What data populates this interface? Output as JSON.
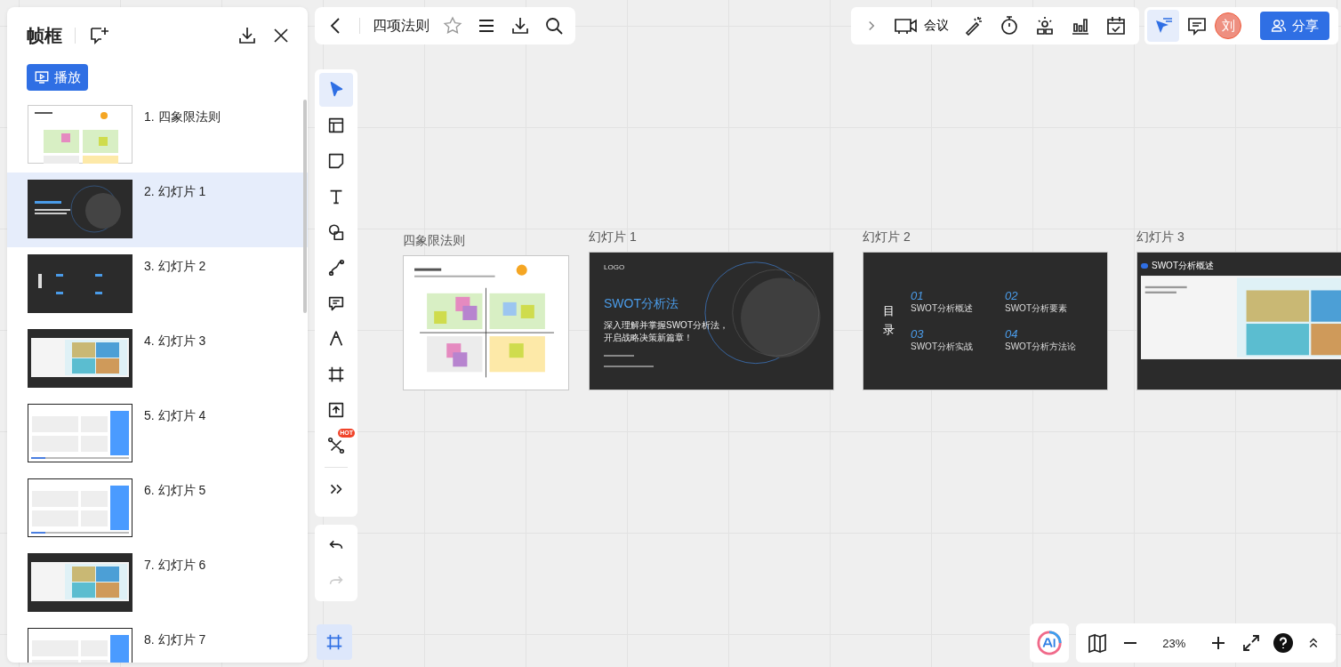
{
  "sidebar": {
    "title": "帧框",
    "play_button": "播放",
    "frames": [
      {
        "label": "1. 四象限法则",
        "kind": "quadrant",
        "selected": false
      },
      {
        "label": "2. 幻灯片 1",
        "kind": "title",
        "selected": true
      },
      {
        "label": "3. 幻灯片 2",
        "kind": "toc",
        "selected": false
      },
      {
        "label": "4. 幻灯片 3",
        "kind": "matrix",
        "selected": false
      },
      {
        "label": "5. 幻灯片 4",
        "kind": "list",
        "selected": false
      },
      {
        "label": "6. 幻灯片 5",
        "kind": "list",
        "selected": false
      },
      {
        "label": "7. 幻灯片 6",
        "kind": "matrix",
        "selected": false
      },
      {
        "label": "8. 幻灯片 7",
        "kind": "list",
        "selected": false
      }
    ]
  },
  "topbar": {
    "title": "四项法则"
  },
  "tools": [
    {
      "kind": "pointer",
      "selected": true
    },
    {
      "kind": "layout",
      "selected": false
    },
    {
      "kind": "sticky",
      "selected": false
    },
    {
      "kind": "text",
      "selected": false
    },
    {
      "kind": "shapes",
      "selected": false
    },
    {
      "kind": "connector",
      "selected": false
    },
    {
      "kind": "comment",
      "selected": false
    },
    {
      "kind": "pen",
      "selected": false
    },
    {
      "kind": "frame",
      "selected": false
    },
    {
      "kind": "upload",
      "selected": false
    },
    {
      "kind": "mindmap",
      "selected": false,
      "badge": "HOT"
    },
    {
      "kind": "more",
      "selected": false
    }
  ],
  "history_buttons": [
    {
      "kind": "undo",
      "disabled": false
    },
    {
      "kind": "redo",
      "disabled": true
    }
  ],
  "frame_button": {
    "selected": true
  },
  "meeting_label": "会议",
  "follow_button": {
    "selected": true
  },
  "avatar": "刘",
  "share_button": "分享",
  "zoom": "23%",
  "canvas_frames": [
    {
      "title": "四象限法则",
      "kind": "quadrant"
    },
    {
      "title": "幻灯片 1",
      "kind": "title",
      "logo": "LOGO",
      "heading": "SWOT分析法",
      "subtitle_lines": [
        "深入理解并掌握SWOT分析法，",
        "开启战略决策新篇章！"
      ]
    },
    {
      "title": "幻灯片 2",
      "kind": "toc",
      "heading": "目录",
      "entries": [
        {
          "number": "01",
          "label": "SWOT分析概述"
        },
        {
          "number": "02",
          "label": "SWOT分析要素"
        },
        {
          "number": "03",
          "label": "SWOT分析实战"
        },
        {
          "number": "04",
          "label": "SWOT分析方法论"
        }
      ]
    },
    {
      "title": "幻灯片 3",
      "kind": "matrix",
      "heading": "SWOT分析概述"
    }
  ]
}
